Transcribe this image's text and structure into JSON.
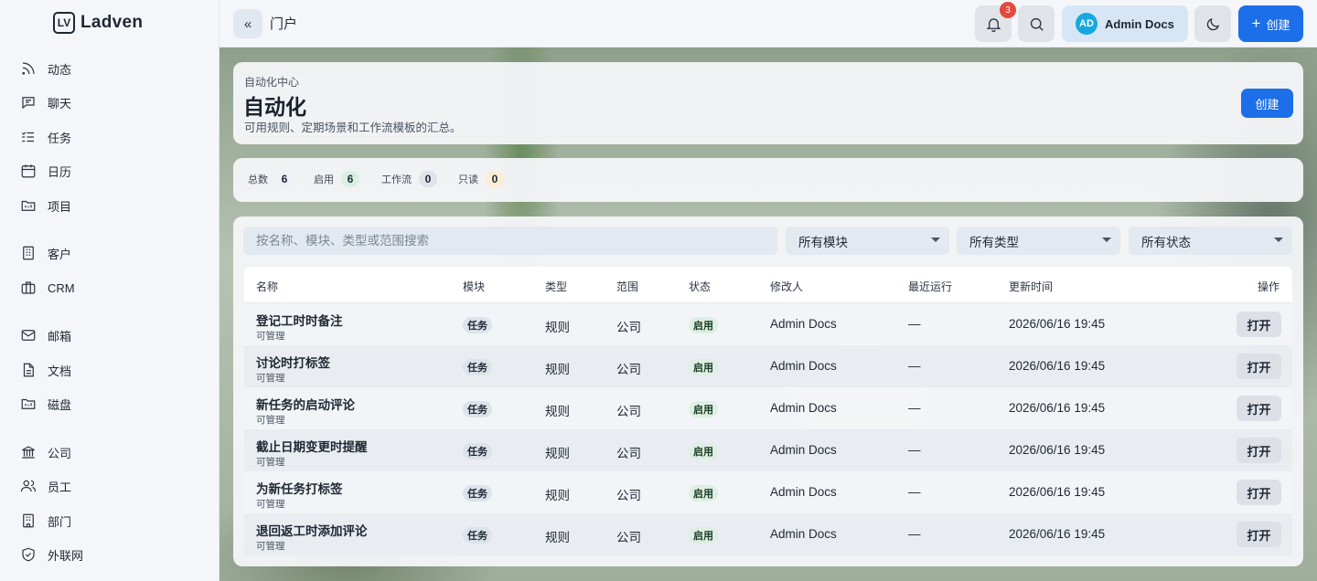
{
  "brand": {
    "name": "Ladven",
    "mark": "LV"
  },
  "sidebar": {
    "items": [
      {
        "label": "动态",
        "icon": "rss-icon"
      },
      {
        "label": "聊天",
        "icon": "chat-icon"
      },
      {
        "label": "任务",
        "icon": "task-list-icon"
      },
      {
        "label": "日历",
        "icon": "calendar-icon"
      },
      {
        "label": "项目",
        "icon": "folder-icon"
      },
      {
        "label": "客户",
        "icon": "building-icon"
      },
      {
        "label": "CRM",
        "icon": "briefcase-icon"
      },
      {
        "label": "邮箱",
        "icon": "mail-icon"
      },
      {
        "label": "文档",
        "icon": "document-icon"
      },
      {
        "label": "磁盘",
        "icon": "drive-icon"
      },
      {
        "label": "公司",
        "icon": "bank-icon"
      },
      {
        "label": "员工",
        "icon": "users-icon"
      },
      {
        "label": "部门",
        "icon": "department-icon"
      },
      {
        "label": "外联网",
        "icon": "shield-icon"
      }
    ]
  },
  "topbar": {
    "collapse_label": "«",
    "crumb": "门户",
    "notifications_count": "3",
    "user_initials": "AD",
    "user_name": "Admin Docs",
    "create_label": "创建",
    "create_plus": "+"
  },
  "header": {
    "eyebrow": "自动化中心",
    "title": "自动化",
    "description": "可用规则、定期场景和工作流模板的汇总。",
    "create_label": "创建"
  },
  "stats": [
    {
      "label": "总数",
      "value": "6",
      "color": "#e7ebf0"
    },
    {
      "label": "启用",
      "value": "6",
      "color": "#d9efe0"
    },
    {
      "label": "工作流",
      "value": "0",
      "color": "#dfe3ea"
    },
    {
      "label": "只读",
      "value": "0",
      "color": "#fbeed3"
    }
  ],
  "filters": {
    "search_placeholder": "按名称、模块、类型或范围搜索",
    "module": "所有模块",
    "type": "所有类型",
    "status": "所有状态"
  },
  "table": {
    "columns": {
      "name": "名称",
      "module": "模块",
      "type": "类型",
      "scope": "范围",
      "status": "状态",
      "modifier": "修改人",
      "last_run": "最近运行",
      "updated": "更新时间",
      "actions": "操作"
    },
    "rows": [
      {
        "name": "登记工时时备注",
        "sub": "可管理",
        "module": "任务",
        "type": "规则",
        "scope": "公司",
        "status": "启用",
        "modifier": "Admin Docs",
        "last_run": "—",
        "updated": "2026/06/16 19:45",
        "action": "打开"
      },
      {
        "name": "讨论时打标签",
        "sub": "可管理",
        "module": "任务",
        "type": "规则",
        "scope": "公司",
        "status": "启用",
        "modifier": "Admin Docs",
        "last_run": "—",
        "updated": "2026/06/16 19:45",
        "action": "打开"
      },
      {
        "name": "新任务的启动评论",
        "sub": "可管理",
        "module": "任务",
        "type": "规则",
        "scope": "公司",
        "status": "启用",
        "modifier": "Admin Docs",
        "last_run": "—",
        "updated": "2026/06/16 19:45",
        "action": "打开"
      },
      {
        "name": "截止日期变更时提醒",
        "sub": "可管理",
        "module": "任务",
        "type": "规则",
        "scope": "公司",
        "status": "启用",
        "modifier": "Admin Docs",
        "last_run": "—",
        "updated": "2026/06/16 19:45",
        "action": "打开"
      },
      {
        "name": "为新任务打标签",
        "sub": "可管理",
        "module": "任务",
        "type": "规则",
        "scope": "公司",
        "status": "启用",
        "modifier": "Admin Docs",
        "last_run": "—",
        "updated": "2026/06/16 19:45",
        "action": "打开"
      },
      {
        "name": "退回返工时添加评论",
        "sub": "可管理",
        "module": "任务",
        "type": "规则",
        "scope": "公司",
        "status": "启用",
        "modifier": "Admin Docs",
        "last_run": "—",
        "updated": "2026/06/16 19:45",
        "action": "打开"
      }
    ]
  }
}
